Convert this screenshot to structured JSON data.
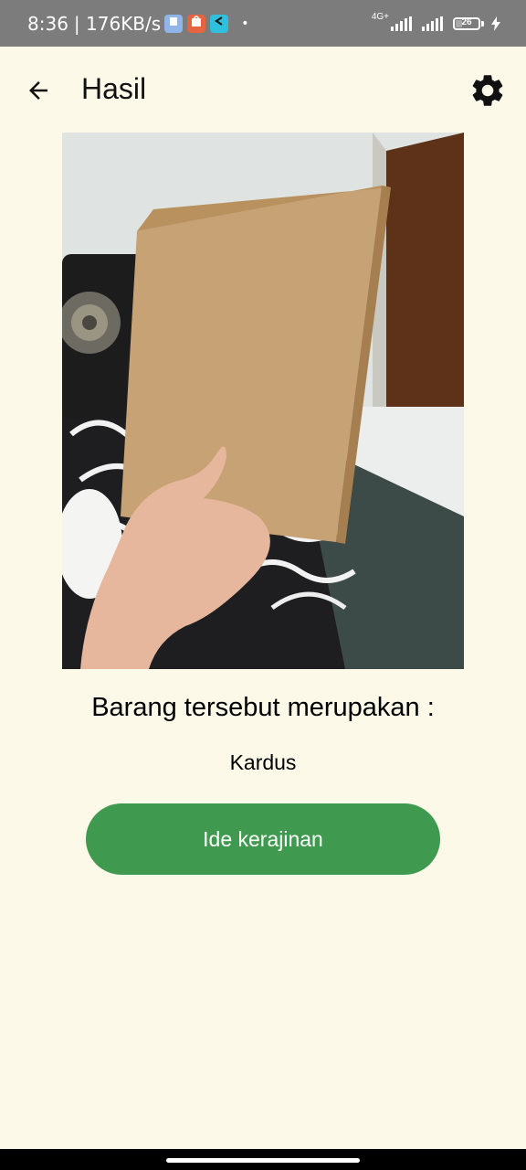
{
  "status_bar": {
    "time": "8:36",
    "net_speed": "| 176KB/s",
    "network_type": "4G+",
    "battery_level": "26"
  },
  "app_bar": {
    "title": "Hasil",
    "back_icon": "arrow-left-icon",
    "settings_icon": "gear-icon"
  },
  "result": {
    "heading": "Barang tersebut merupakan :",
    "value": "Kardus",
    "button_label": "Ide kerajinan"
  },
  "colors": {
    "background": "#fdf9e9",
    "button": "#3f9a4f",
    "status_bar": "#7c7c7c"
  }
}
